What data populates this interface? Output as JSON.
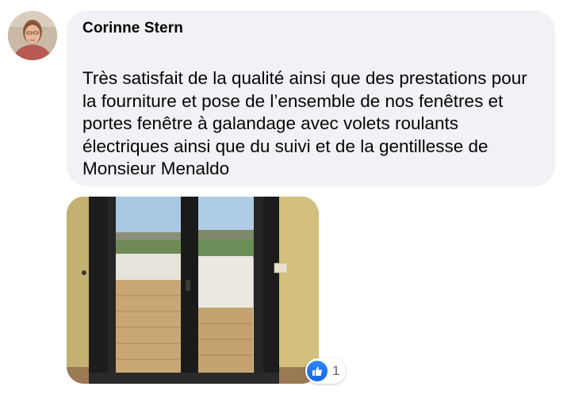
{
  "comment": {
    "author": "Corinne Stern",
    "text": "Très satisfait de la qualité ainsi que des prestations pour la fourniture et pose de l’ensemble de nos fenêtres et portes fenêtre à galandage avec volets roulants électriques ainsi que du suivi et de la gentillesse de Monsieur Menaldo",
    "reactions": {
      "icon": "like-icon",
      "count": "1"
    }
  },
  "colors": {
    "bubble_bg": "#f0f2f5",
    "text": "#050505",
    "like_blue": "#1877f2",
    "count_gray": "#65676b"
  }
}
